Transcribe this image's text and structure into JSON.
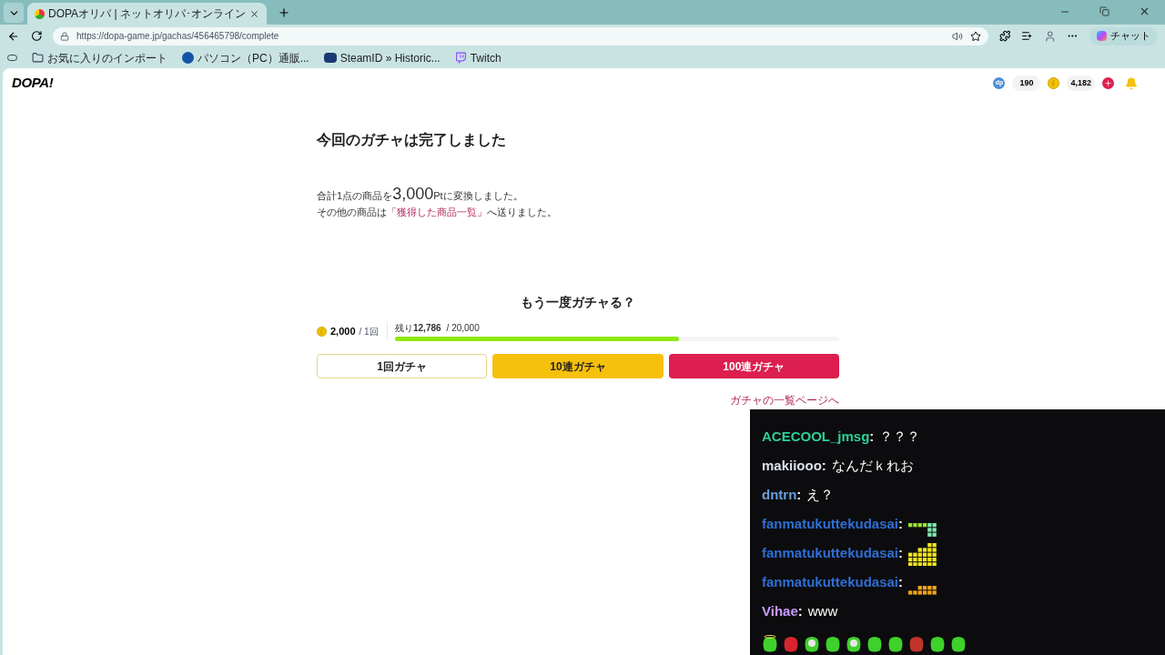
{
  "browser": {
    "tab": {
      "title": "DOPAオリパ | ネットオリパ･オンライン",
      "selected": true
    },
    "url": "https://dopa-game.jp/gachas/456465798/complete",
    "copilot_label": "チャット",
    "bookmarks": [
      {
        "kind": "folder",
        "label": "お気に入りのインポート"
      },
      {
        "kind": "pc",
        "label": "パソコン（PC）通販..."
      },
      {
        "kind": "steam",
        "label": "SteamID » Historic..."
      },
      {
        "kind": "twitch",
        "label": "Twitch"
      }
    ]
  },
  "header": {
    "logo": "DOPA!",
    "dp_badge": "dp",
    "dp_points": "190",
    "coins": "4,182"
  },
  "result": {
    "title": "今回のガチャは完了しました",
    "line1_prefix": "合計1点の商品を",
    "amount": "3,000",
    "line1_suffix": "Ptに変換しました。",
    "line2_prefix": "その他の商品は",
    "line2_link": "「獲得した商品一覧」",
    "line2_suffix": "へ送りました。"
  },
  "again": {
    "title": "もう一度ガチャる？",
    "price": "2,000",
    "per": "/ 1回",
    "remaining_label": "残り",
    "remaining": "12,786",
    "total": "/ 20,000",
    "level": 0.64,
    "buttons": [
      {
        "kind": "outline",
        "label": "1回ガチャ"
      },
      {
        "kind": "yellow",
        "label": "10連ガチャ"
      },
      {
        "kind": "red",
        "label": "100連ガチャ"
      }
    ],
    "list_link": "ガチャの一覧ページへ"
  },
  "chat": {
    "messages": [
      {
        "kind": "text",
        "user": "ACECOOL_jmsg",
        "sep": ":",
        "color": "#2fcf9a",
        "text": "？？？"
      },
      {
        "kind": "text",
        "user": "makiiooo",
        "sep": ":",
        "color": "#d8e0ea",
        "text": "なんだｋれお"
      },
      {
        "kind": "text",
        "user": "dntrn",
        "sep": ":",
        "color": "#6a9fdc",
        "text": "え？"
      },
      {
        "kind": "emote",
        "user": "fanmatukuttekudasai",
        "sep": ":",
        "color": "#2e6fd6"
      },
      {
        "kind": "emote",
        "user": "fanmatukuttekudasai",
        "sep": ":",
        "color": "#2e6fd6"
      },
      {
        "kind": "emote",
        "user": "fanmatukuttekudasai",
        "sep": ":",
        "color": "#2e6fd6"
      },
      {
        "kind": "text",
        "user": "Vihae",
        "sep": ":",
        "color": "#c79bff",
        "text": "www"
      }
    ]
  }
}
